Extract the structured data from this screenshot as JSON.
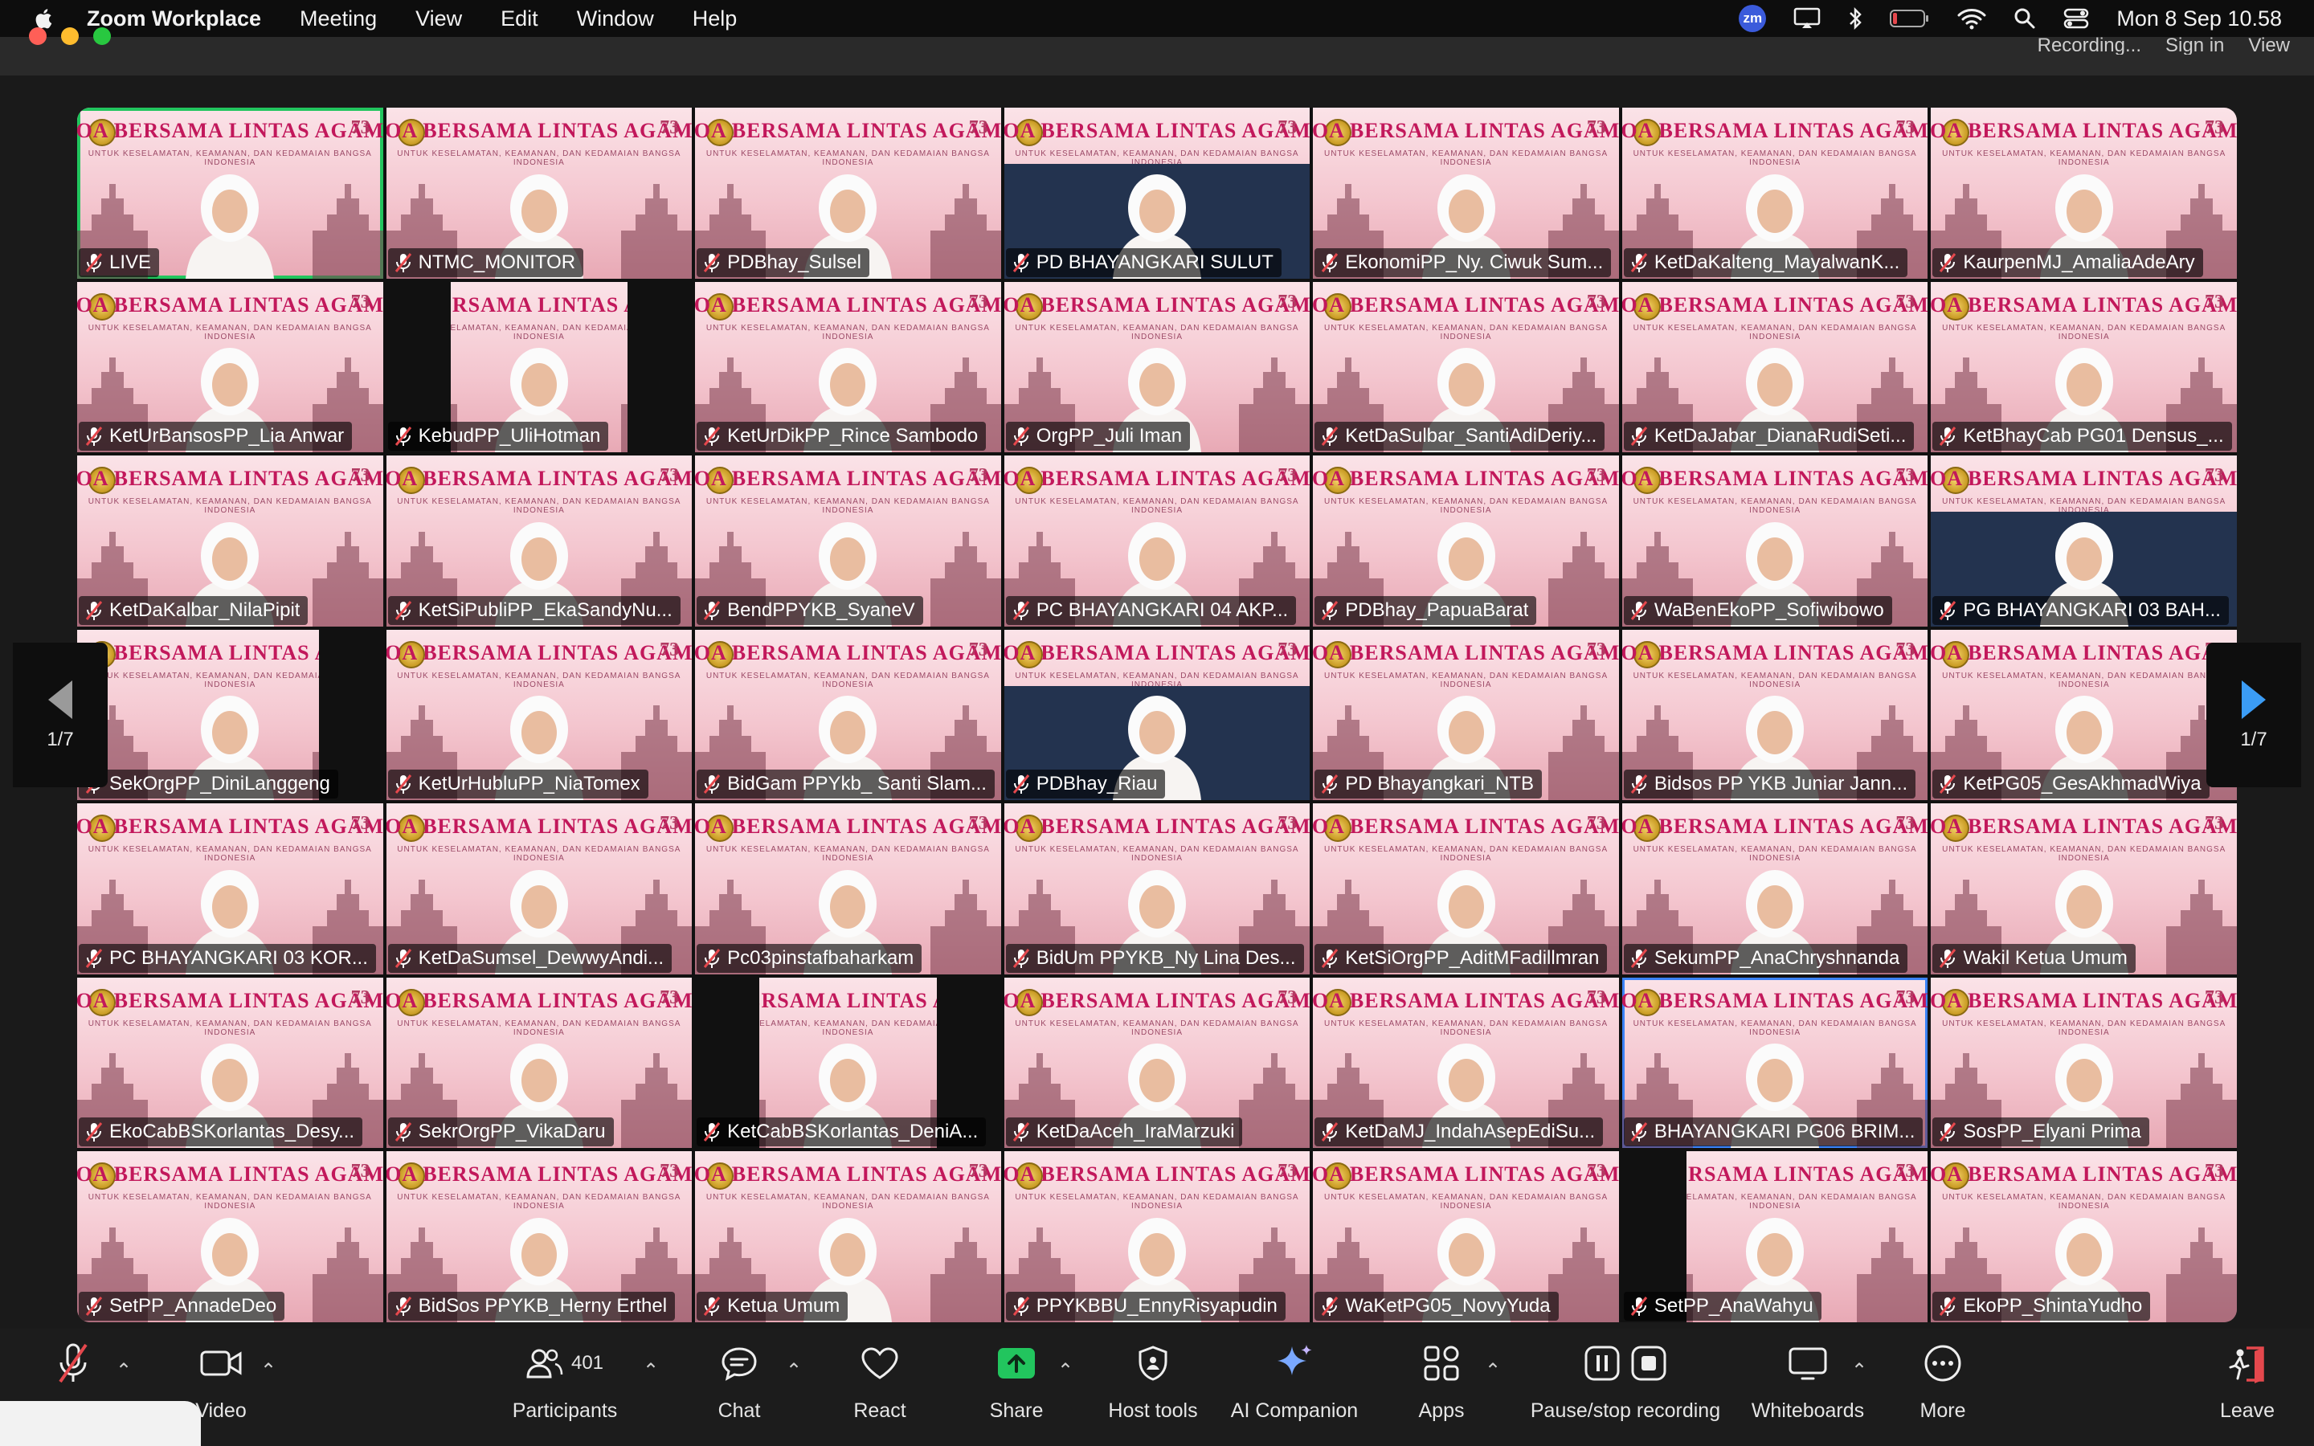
{
  "menubar": {
    "app": "Zoom Workplace",
    "menus": [
      "Meeting",
      "View",
      "Edit",
      "Window",
      "Help"
    ],
    "datetime": "Mon 8 Sep  10.58",
    "zm_badge": "zm"
  },
  "peek": {
    "recording": "Recording...",
    "sign_in": "Sign in",
    "view": "View"
  },
  "banner": {
    "title": "DOA BERSAMA LINTAS AGAMA",
    "subtitle": "UNTUK KESELAMATAN, KEAMANAN, DAN KEDAMAIAN BANGSA INDONESIA",
    "anniversary": "73"
  },
  "gallery": {
    "page_left": "1/7",
    "page_right": "1/7",
    "tiles": [
      {
        "name": "LIVE"
      },
      {
        "name": "NTMC_MONITOR"
      },
      {
        "name": "PDBhay_Sulsel"
      },
      {
        "name": "PD BHAYANGKARI SULUT"
      },
      {
        "name": "EkonomiPP_Ny. Ciwuk Sum..."
      },
      {
        "name": "KetDaKalteng_MayalwanK..."
      },
      {
        "name": "KaurpenMJ_AmaliaAdeAry"
      },
      {
        "name": "KetUrBansosPP_Lia Anwar"
      },
      {
        "name": "KebudPP_UliHotman"
      },
      {
        "name": "KetUrDikPP_Rince Sambodo"
      },
      {
        "name": "OrgPP_Juli Iman"
      },
      {
        "name": "KetDaSulbar_SantiAdiDeriy..."
      },
      {
        "name": "KetDaJabar_DianaRudiSeti..."
      },
      {
        "name": "KetBhayCab PG01 Densus_..."
      },
      {
        "name": "KetDaKalbar_NilaPipit"
      },
      {
        "name": "KetSiPubliPP_EkaSandyNu..."
      },
      {
        "name": "BendPPYKB_SyaneV"
      },
      {
        "name": "PC BHAYANGKARI 04 AKP..."
      },
      {
        "name": "PDBhay_PapuaBarat"
      },
      {
        "name": "WaBenEkoPP_Sofiwibowo"
      },
      {
        "name": "PG BHAYANGKARI 03 BAH..."
      },
      {
        "name": "SekOrgPP_DiniLanggeng"
      },
      {
        "name": "KetUrHubluPP_NiaTomex"
      },
      {
        "name": "BidGam PPYkb_ Santi Slam..."
      },
      {
        "name": "PDBhay_Riau"
      },
      {
        "name": "PD Bhayangkari_NTB"
      },
      {
        "name": "Bidsos PP YKB Juniar Jann..."
      },
      {
        "name": "KetPG05_GesAkhmadWiya"
      },
      {
        "name": "PC BHAYANGKARI 03 KOR..."
      },
      {
        "name": "KetDaSumsel_DewwyAndi..."
      },
      {
        "name": "Pc03pinstafbaharkam"
      },
      {
        "name": "BidUm PPYKB_Ny Lina Des..."
      },
      {
        "name": "KetSiOrgPP_AditMFadillmran"
      },
      {
        "name": "SekumPP_AnaChryshnanda"
      },
      {
        "name": "Wakil Ketua Umum"
      },
      {
        "name": "EkoCabBSKorlantas_Desy..."
      },
      {
        "name": "SekrOrgPP_VikaDaru"
      },
      {
        "name": "KetCabBSKorlantas_DeniA..."
      },
      {
        "name": "KetDaAceh_IraMarzuki"
      },
      {
        "name": "KetDaMJ_IndahAsepEdiSu..."
      },
      {
        "name": "BHAYANGKARI PG06 BRIM..."
      },
      {
        "name": "SosPP_Elyani Prima"
      },
      {
        "name": "SetPP_AnnadeDeo"
      },
      {
        "name": "BidSos PPYKB_Herny Erthel"
      },
      {
        "name": "Ketua Umum"
      },
      {
        "name": "PPYKBBU_EnnyRisyapudin"
      },
      {
        "name": "WaKetPG05_NovyYuda"
      },
      {
        "name": "SetPP_AnaWahyu"
      },
      {
        "name": "EkoPP_ShintaYudho"
      }
    ]
  },
  "toolbar": {
    "video": "Video",
    "participants": "Participants",
    "participants_count": "401",
    "chat": "Chat",
    "react": "React",
    "share": "Share",
    "host_tools": "Host tools",
    "ai_companion": "AI Companion",
    "apps": "Apps",
    "recording": "Pause/stop recording",
    "whiteboards": "Whiteboards",
    "more": "More",
    "leave": "Leave"
  },
  "colors": {
    "banner_pink": "#f4c6cf",
    "banner_text": "#c2185b",
    "active_speaker": "#22c55e",
    "share_green": "#22c55e",
    "mute_red": "#e5484d"
  }
}
